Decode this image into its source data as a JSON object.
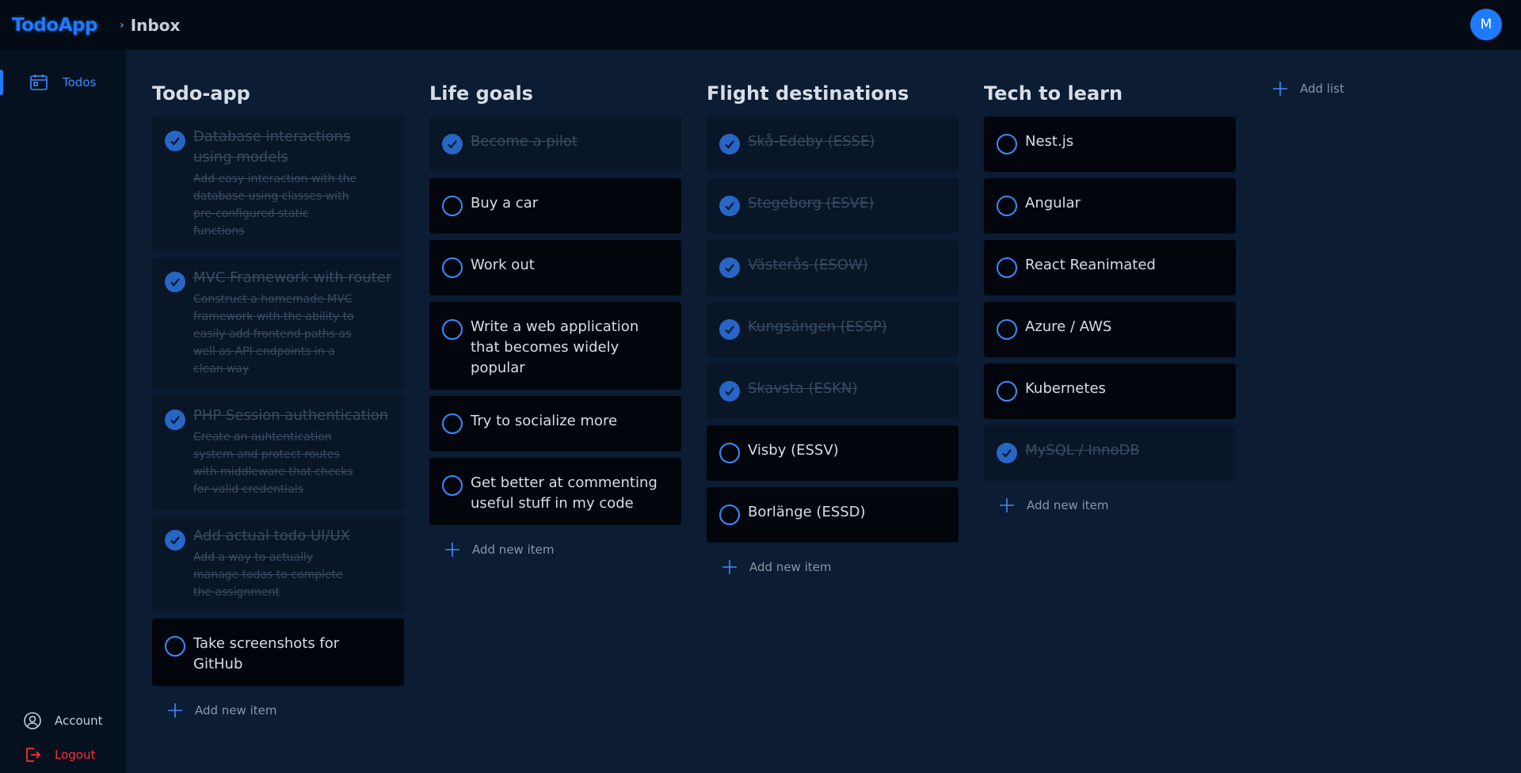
{
  "topbar": {
    "logo": "TodoApp",
    "breadcrumb_sep": "›",
    "breadcrumb": "Inbox",
    "avatar_initial": "M"
  },
  "sidebar": {
    "todos": "Todos",
    "account": "Account",
    "logout": "Logout"
  },
  "colors": {
    "accent": "#1e7bff",
    "logout": "#ff2b3a",
    "done_check": "#2866c6"
  },
  "lists": [
    {
      "title": "Todo-app",
      "items": [
        {
          "title": "Database interactions using models",
          "desc": "Add easy interaction with the database using classes with pre-configured static functions",
          "done": true
        },
        {
          "title": "MVC Framework with router",
          "desc": "Construct a homemade MVC framework with the ability to easily add frontend paths as well as API endpoints in a clean way",
          "done": true
        },
        {
          "title": "PHP Session authentication",
          "desc": "Create an auhtentication system and protect routes with middleware that checks for valid credentials",
          "done": true
        },
        {
          "title": "Add actual todo UI/UX",
          "desc": "Add a way to actually manage todos to complete the assignment",
          "done": true
        },
        {
          "title": "Take screenshots for GitHub",
          "done": false
        }
      ],
      "add_label": "Add new item"
    },
    {
      "title": "Life goals",
      "items": [
        {
          "title": "Become a pilot",
          "done": true
        },
        {
          "title": "Buy a car",
          "done": false
        },
        {
          "title": "Work out",
          "done": false
        },
        {
          "title": "Write a web application that becomes widely popular",
          "done": false
        },
        {
          "title": "Try to socialize more",
          "done": false
        },
        {
          "title": "Get better at commenting useful stuff in my code",
          "done": false
        }
      ],
      "add_label": "Add new item"
    },
    {
      "title": "Flight destinations",
      "items": [
        {
          "title": "Skå-Edeby (ESSE)",
          "done": true
        },
        {
          "title": "Stegeborg (ESVE)",
          "done": true
        },
        {
          "title": "Västerås (ESOW)",
          "done": true
        },
        {
          "title": "Kungsängen (ESSP)",
          "done": true
        },
        {
          "title": "Skavsta (ESKN)",
          "done": true
        },
        {
          "title": "Visby (ESSV)",
          "done": false
        },
        {
          "title": "Borlänge (ESSD)",
          "done": false
        }
      ],
      "add_label": "Add new item"
    },
    {
      "title": "Tech to learn",
      "items": [
        {
          "title": "Nest.js",
          "done": false
        },
        {
          "title": "Angular",
          "done": false
        },
        {
          "title": "React Reanimated",
          "done": false
        },
        {
          "title": "Azure / AWS",
          "done": false
        },
        {
          "title": "Kubernetes",
          "done": false
        },
        {
          "title": "MySQL / InnoDB",
          "done": true
        }
      ],
      "add_label": "Add new item"
    }
  ],
  "add_list_label": "Add list"
}
